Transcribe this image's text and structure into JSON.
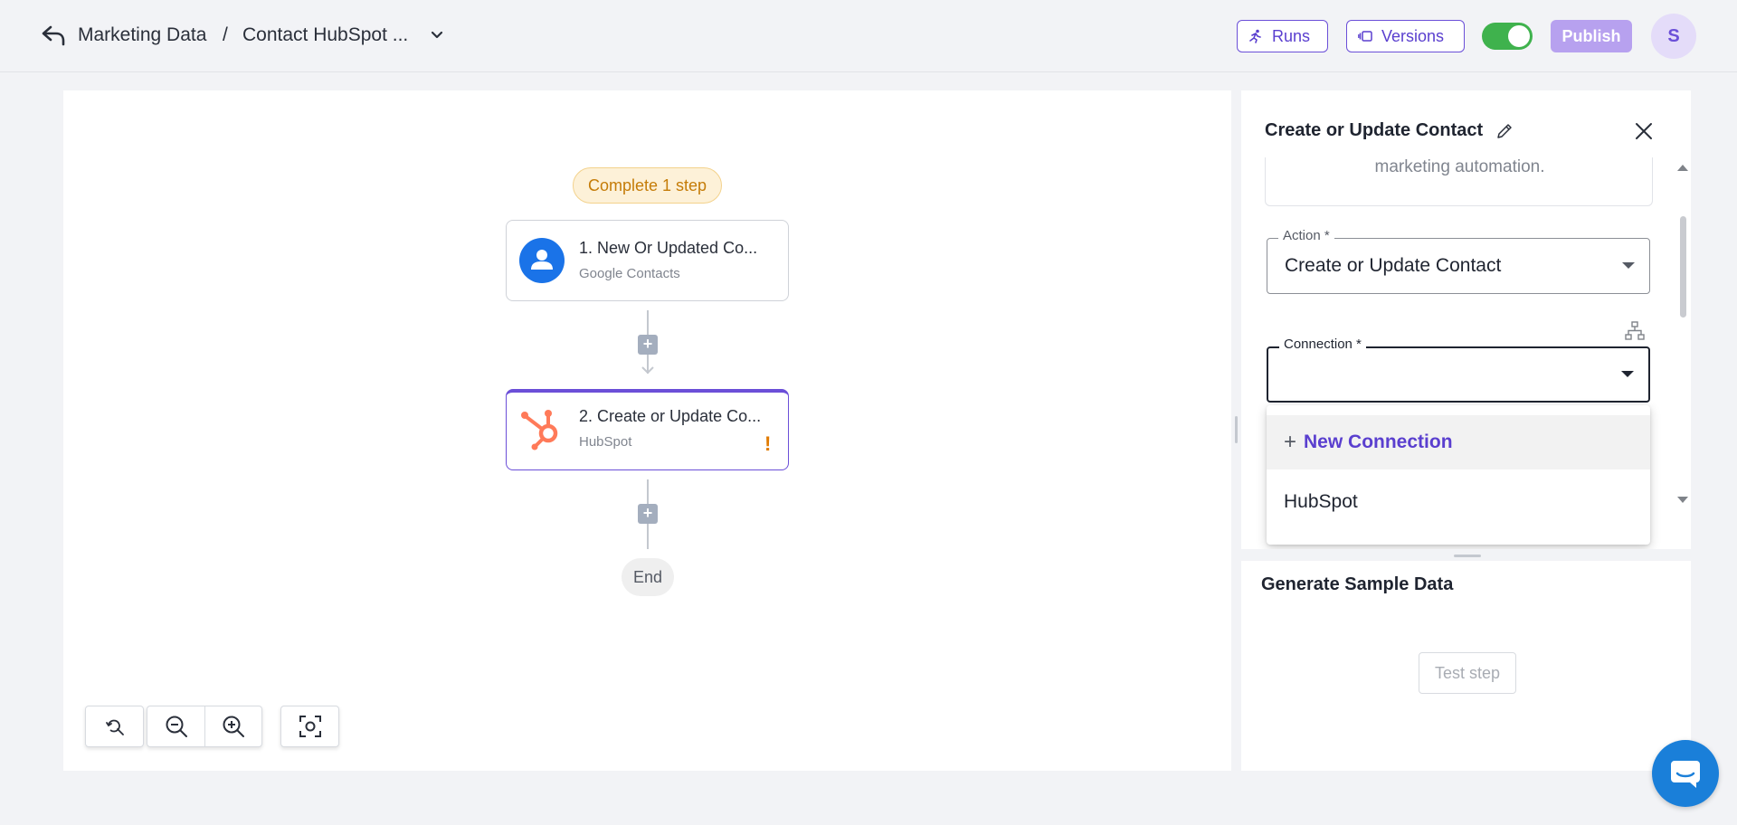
{
  "header": {
    "breadcrumb_project": "Marketing Data",
    "breadcrumb_separator": "/",
    "breadcrumb_flow": "Contact HubSpot ...",
    "runs_label": "Runs",
    "versions_label": "Versions",
    "publish_label": "Publish",
    "avatar_initial": "S",
    "enabled": true
  },
  "canvas": {
    "status_pill": "Complete 1 step",
    "steps": [
      {
        "title": "1. New Or Updated Co...",
        "app": "Google Contacts",
        "icon": "person-icon"
      },
      {
        "title": "2. Create or Update Co...",
        "app": "HubSpot",
        "icon": "hubspot-icon",
        "warning": "!"
      }
    ],
    "end_label": "End",
    "add_step_glyph": "+"
  },
  "panel": {
    "title": "Create or Update Contact",
    "description_tail": "marketing automation.",
    "action": {
      "label": "Action *",
      "value": "Create or Update Contact"
    },
    "connection": {
      "label": "Connection *",
      "value": ""
    },
    "dropdown": {
      "new_connection_label": "New Connection",
      "options": [
        "HubSpot"
      ]
    },
    "sample": {
      "title": "Generate Sample Data",
      "test_button": "Test step"
    }
  },
  "colors": {
    "accent": "#6b4fd8",
    "toggle_on": "#3fb24d",
    "warning": "#e07a00",
    "hubspot": "#ff7a59",
    "google_contacts": "#1a73e8"
  }
}
